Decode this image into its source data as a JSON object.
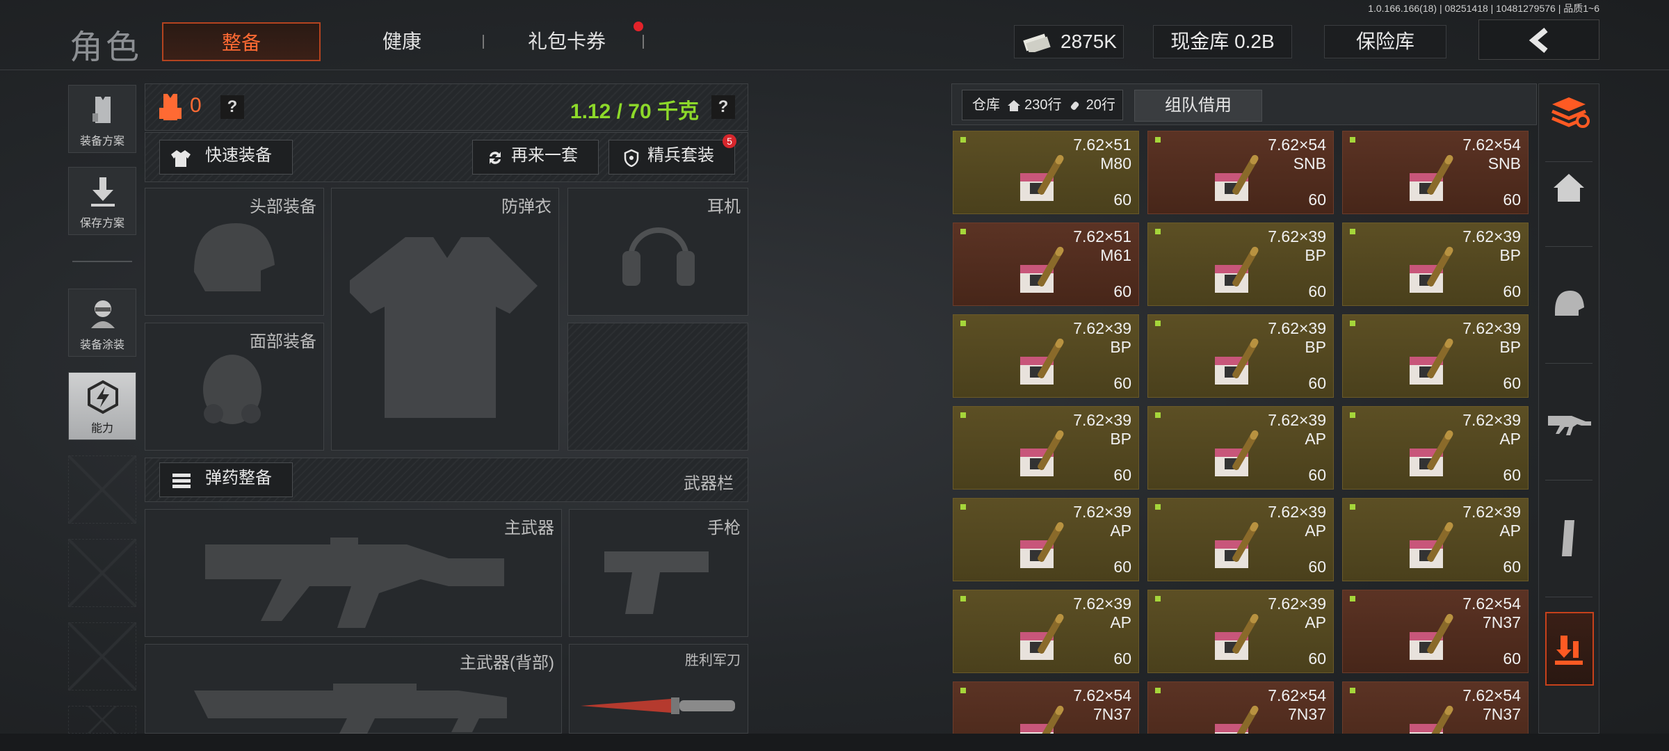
{
  "version_text": "1.0.166.166(18) | 08251418 | 10481279576 | 品质1~6",
  "header": {
    "title": "角色",
    "tabs": [
      {
        "label": "整备",
        "active": true
      },
      {
        "label": "健康",
        "active": false
      },
      {
        "label": "礼包卡券",
        "active": false,
        "badge": true
      }
    ],
    "money": "2875K",
    "cash_vault": "现金库 0.2B",
    "insurance": "保险库"
  },
  "sidebar": {
    "items": [
      {
        "label": "装备方案",
        "icon": "vest-plan-icon"
      },
      {
        "label": "保存方案",
        "icon": "save-download-icon"
      },
      {
        "label": "装备涂装",
        "icon": "soldier-skin-icon"
      },
      {
        "label": "能力",
        "icon": "ability-lightning-icon",
        "active": true
      }
    ]
  },
  "loadout": {
    "armor_count": "0",
    "weight": "1.12 / 70 千克",
    "help": "?",
    "quick_equip": "快速装备",
    "another_set": "再来一套",
    "elite_set": "精兵套装",
    "elite_badge": "5",
    "slots": {
      "head": "头部装备",
      "vest": "防弹衣",
      "earphone": "耳机",
      "face": "面部装备"
    },
    "ammo_equip": "弹药整备",
    "weapon_bar": "武器栏",
    "weapons": {
      "primary": "主武器",
      "pistol": "手枪",
      "primary_back": "主武器(背部)",
      "knife": "胜利军刀"
    }
  },
  "inventory": {
    "title": "仓库",
    "rows_home": "230行",
    "rows_item": "20行",
    "team_borrow": "组队借用",
    "items": [
      {
        "cal": "7.62×51",
        "type": "M80",
        "qty": "60",
        "color": "olive"
      },
      {
        "cal": "7.62×54",
        "type": "SNB",
        "qty": "60",
        "color": "rust"
      },
      {
        "cal": "7.62×54",
        "type": "SNB",
        "qty": "60",
        "color": "rust"
      },
      {
        "cal": "7.62×51",
        "type": "M61",
        "qty": "60",
        "color": "rust"
      },
      {
        "cal": "7.62×39",
        "type": "BP",
        "qty": "60",
        "color": "olive"
      },
      {
        "cal": "7.62×39",
        "type": "BP",
        "qty": "60",
        "color": "olive"
      },
      {
        "cal": "7.62×39",
        "type": "BP",
        "qty": "60",
        "color": "olive"
      },
      {
        "cal": "7.62×39",
        "type": "BP",
        "qty": "60",
        "color": "olive"
      },
      {
        "cal": "7.62×39",
        "type": "BP",
        "qty": "60",
        "color": "olive"
      },
      {
        "cal": "7.62×39",
        "type": "BP",
        "qty": "60",
        "color": "olive"
      },
      {
        "cal": "7.62×39",
        "type": "AP",
        "qty": "60",
        "color": "olive"
      },
      {
        "cal": "7.62×39",
        "type": "AP",
        "qty": "60",
        "color": "olive"
      },
      {
        "cal": "7.62×39",
        "type": "AP",
        "qty": "60",
        "color": "olive"
      },
      {
        "cal": "7.62×39",
        "type": "AP",
        "qty": "60",
        "color": "olive"
      },
      {
        "cal": "7.62×39",
        "type": "AP",
        "qty": "60",
        "color": "olive"
      },
      {
        "cal": "7.62×39",
        "type": "AP",
        "qty": "60",
        "color": "olive"
      },
      {
        "cal": "7.62×39",
        "type": "AP",
        "qty": "60",
        "color": "olive"
      },
      {
        "cal": "7.62×54",
        "type": "7N37",
        "qty": "60",
        "color": "rust"
      },
      {
        "cal": "7.62×54",
        "type": "7N37",
        "qty": "",
        "color": "rust"
      },
      {
        "cal": "7.62×54",
        "type": "7N37",
        "qty": "",
        "color": "rust"
      },
      {
        "cal": "7.62×54",
        "type": "7N37",
        "qty": "",
        "color": "rust"
      }
    ]
  },
  "right_bar": {
    "icons": [
      "sort-stack-icon",
      "home-icon",
      "helmet-icon",
      "rifle-icon",
      "magazine-icon",
      "warehouse-transfer-icon"
    ]
  },
  "colors": {
    "accent": "#ff6a33",
    "weight": "#8dd92a",
    "olive_item": "#5c4f24",
    "rust_item": "#5b3324"
  }
}
